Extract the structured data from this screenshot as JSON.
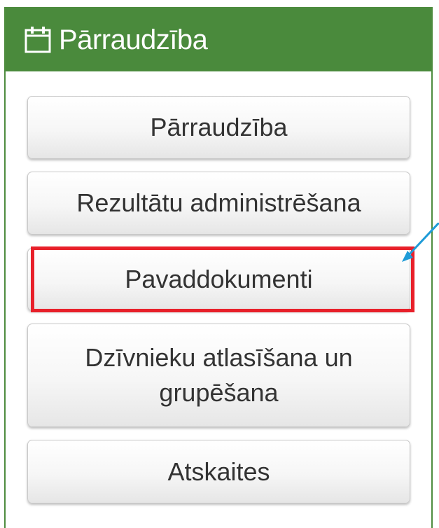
{
  "panel": {
    "title": "Pārraudzība",
    "header_icon": "calendar-icon",
    "header_color": "#4a8a3c",
    "buttons": [
      {
        "label": "Pārraudzība"
      },
      {
        "label": "Rezultātu administrēšana"
      },
      {
        "label": "Pavaddokumenti"
      },
      {
        "label": "Dzīvnieku atlasīšana un grupēšana"
      },
      {
        "label": "Atskaites"
      }
    ]
  },
  "annotation": {
    "highlight_color": "#e8202a",
    "arrow_color": "#1e9bd7",
    "highlighted_button": "Pavaddokumenti"
  }
}
